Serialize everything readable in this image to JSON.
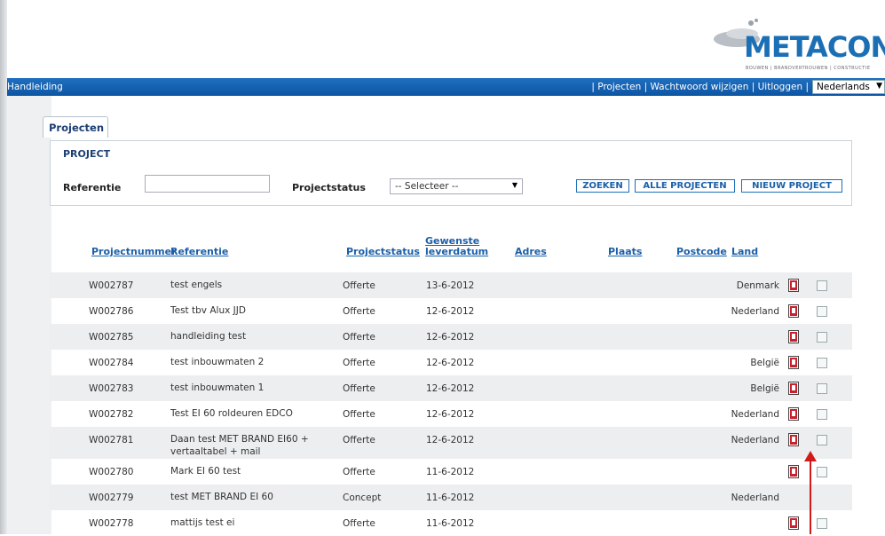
{
  "logo": {
    "text": "METACON",
    "tagline": "BOUWEN | BRANDVERTROUWEN | CONSTRUCTIE",
    "brand_color": "#1b6fb5"
  },
  "navbar": {
    "left_link": "Handleiding",
    "links": [
      "| Projecten",
      "| Wachtwoord wijzigen",
      "| Uitloggen",
      "|"
    ],
    "language": "Nederlands",
    "bar_color": "#0d55a3"
  },
  "tab": {
    "label": "Projecten"
  },
  "search": {
    "heading": "PROJECT",
    "referentie_label": "Referentie",
    "referentie_value": "",
    "projectstatus_label": "Projectstatus",
    "projectstatus_value": "-- Selecteer --",
    "zoeken": "ZOEKEN",
    "alle_projecten": "ALLE PROJECTEN",
    "nieuw_project": "NIEUW PROJECT"
  },
  "table": {
    "headers": {
      "projectnummer": "Projectnummer",
      "referentie": "Referentie",
      "projectstatus": "Projectstatus",
      "leverdatum_1": "Gewenste",
      "leverdatum_2": "leverdatum",
      "adres": "Adres",
      "plaats": "Plaats",
      "postcode": "Postcode",
      "land": "Land"
    },
    "rows": [
      {
        "num": "W002787",
        "ref": "test engels",
        "status": "Offerte",
        "date": "13-6-2012",
        "land": "Denmark",
        "pdf": true
      },
      {
        "num": "W002786",
        "ref": "Test tbv Alux JJD",
        "status": "Offerte",
        "date": "12-6-2012",
        "land": "Nederland",
        "pdf": true
      },
      {
        "num": "W002785",
        "ref": "handleiding test",
        "status": "Offerte",
        "date": "12-6-2012",
        "land": "",
        "pdf": true
      },
      {
        "num": "W002784",
        "ref": "test inbouwmaten 2",
        "status": "Offerte",
        "date": "12-6-2012",
        "land": "België",
        "pdf": true
      },
      {
        "num": "W002783",
        "ref": "test inbouwmaten 1",
        "status": "Offerte",
        "date": "12-6-2012",
        "land": "België",
        "pdf": true
      },
      {
        "num": "W002782",
        "ref": "Test EI 60 roldeuren EDCO",
        "status": "Offerte",
        "date": "12-6-2012",
        "land": "Nederland",
        "pdf": true
      },
      {
        "num": "W002781",
        "ref": "Daan test MET BRAND EI60 + vertaaltabel + mail",
        "status": "Offerte",
        "date": "12-6-2012",
        "land": "Nederland",
        "pdf": true
      },
      {
        "num": "W002780",
        "ref": "Mark EI 60 test",
        "status": "Offerte",
        "date": "11-6-2012",
        "land": "",
        "pdf": true
      },
      {
        "num": "W002779",
        "ref": "test MET BRAND EI 60",
        "status": "Concept",
        "date": "11-6-2012",
        "land": "Nederland",
        "pdf": false
      },
      {
        "num": "W002778",
        "ref": "mattijs test ei",
        "status": "Offerte",
        "date": "11-6-2012",
        "land": "",
        "pdf": true
      }
    ]
  }
}
